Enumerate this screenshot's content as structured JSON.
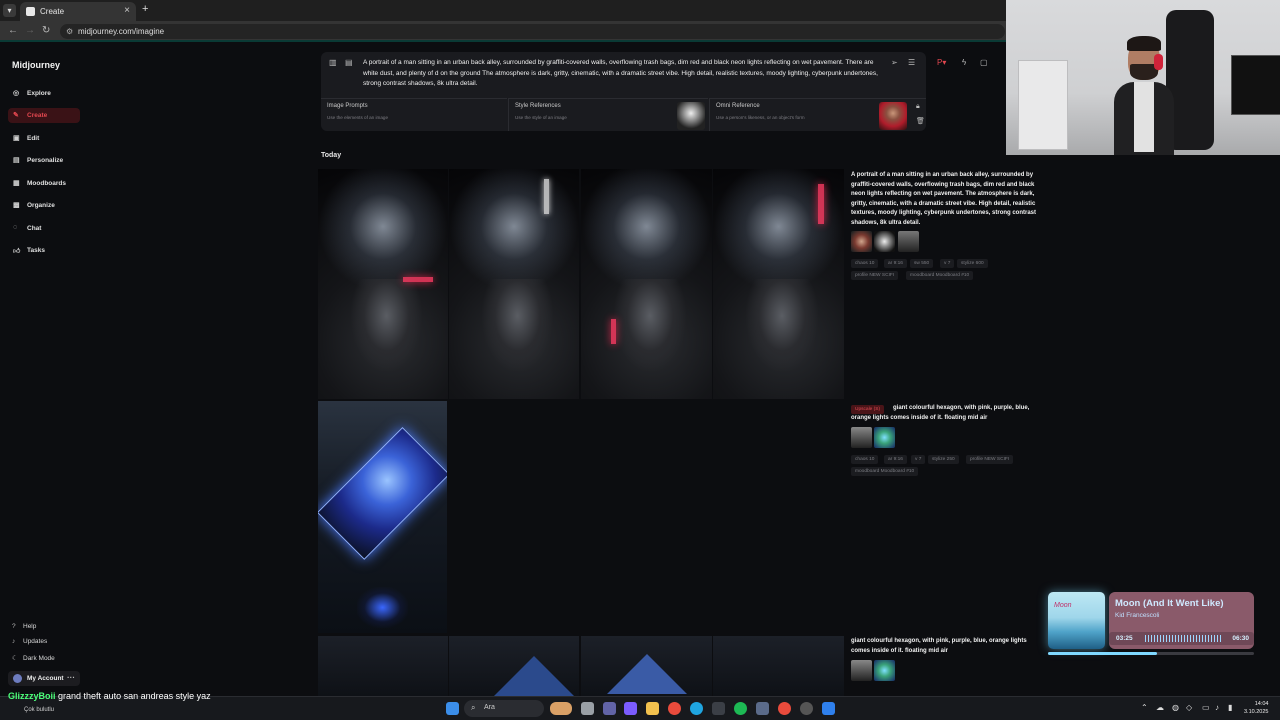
{
  "browser": {
    "tab_title": "Create",
    "url": "midjourney.com/imagine"
  },
  "sidebar": {
    "brand": "Midjourney",
    "items": [
      {
        "label": "Explore",
        "icon": "compass-icon"
      },
      {
        "label": "Create",
        "icon": "paintbrush-icon",
        "active": true
      },
      {
        "label": "Edit",
        "icon": "edit-icon"
      },
      {
        "label": "Personalize",
        "icon": "personalize-icon"
      },
      {
        "label": "Moodboards",
        "icon": "moodboard-icon"
      },
      {
        "label": "Organize",
        "icon": "grid-icon"
      },
      {
        "label": "Chat",
        "icon": "chat-icon"
      },
      {
        "label": "Tasks",
        "icon": "thumbs-up-icon"
      }
    ],
    "bottom": [
      {
        "label": "Help",
        "icon": "help-icon"
      },
      {
        "label": "Updates",
        "icon": "bell-icon"
      },
      {
        "label": "Dark Mode",
        "icon": "moon-icon"
      }
    ],
    "account_label": "My Account"
  },
  "prompt": {
    "text": "A portrait of a man sitting in an urban back alley, surrounded by graffiti-covered walls, overflowing trash bags, dim red and black neon lights reflecting on wet pavement. There are white dust, and plenty of d on the ground The atmosphere is dark, gritty, cinematic, with a dramatic street vibe. High detail, realistic textures, moody lighting, cyberpunk undertones, strong contrast shadows, 8k ultra detail.",
    "references": [
      {
        "title": "Image Prompts",
        "subtitle": "Use the elements of an image"
      },
      {
        "title": "Style References",
        "subtitle": "Use the style of an image"
      },
      {
        "title": "Omni Reference",
        "subtitle": "Use a person's likeness, or an object's form"
      }
    ]
  },
  "feed": {
    "section_label": "Today",
    "jobs": [
      {
        "prompt": "A portrait of a man sitting in an urban back alley, surrounded by graffiti-covered walls, overflowing trash bags, dim red and black neon lights reflecting on wet pavement. The atmosphere is dark, gritty, cinematic, with a dramatic street vibe. High detail, realistic textures, moody lighting, cyberpunk undertones, strong contrast shadows, 8k ultra detail.",
        "chips_row1": [
          "chaos 10",
          "ar 9:16",
          "sw 550",
          "v 7",
          "stylize 600"
        ],
        "chips_row2": [
          "profile NEW SCIFI",
          "moodboard Moodboard #10"
        ]
      },
      {
        "badge": "Upscale (S)",
        "prompt": "giant colourful hexagon, with pink, purple, blue, orange lights comes inside of it. floating mid air",
        "chips_row1": [
          "chaos 10",
          "ar 9:16",
          "v 7",
          "stylize 250",
          "profile NEW SCIFI"
        ],
        "chips_row2": [
          "moodboard Moodboard #10"
        ]
      },
      {
        "prompt": "giant colourful hexagon, with pink, purple, blue, orange lights comes inside of it. floating mid air"
      }
    ]
  },
  "music": {
    "art_text": "Moon",
    "title": "Moon (And It Went Like)",
    "artist": "Kid Francescoli",
    "current": "03:25",
    "total": "06:30",
    "progress": 0.53
  },
  "chat": {
    "user": "GlizzzyBoii",
    "message": "grand theft auto san andreas style yaz",
    "toast": "Çok bulutlu"
  },
  "taskbar": {
    "search_label": "Ara",
    "time": "14:04",
    "date": "3.10.2025"
  }
}
